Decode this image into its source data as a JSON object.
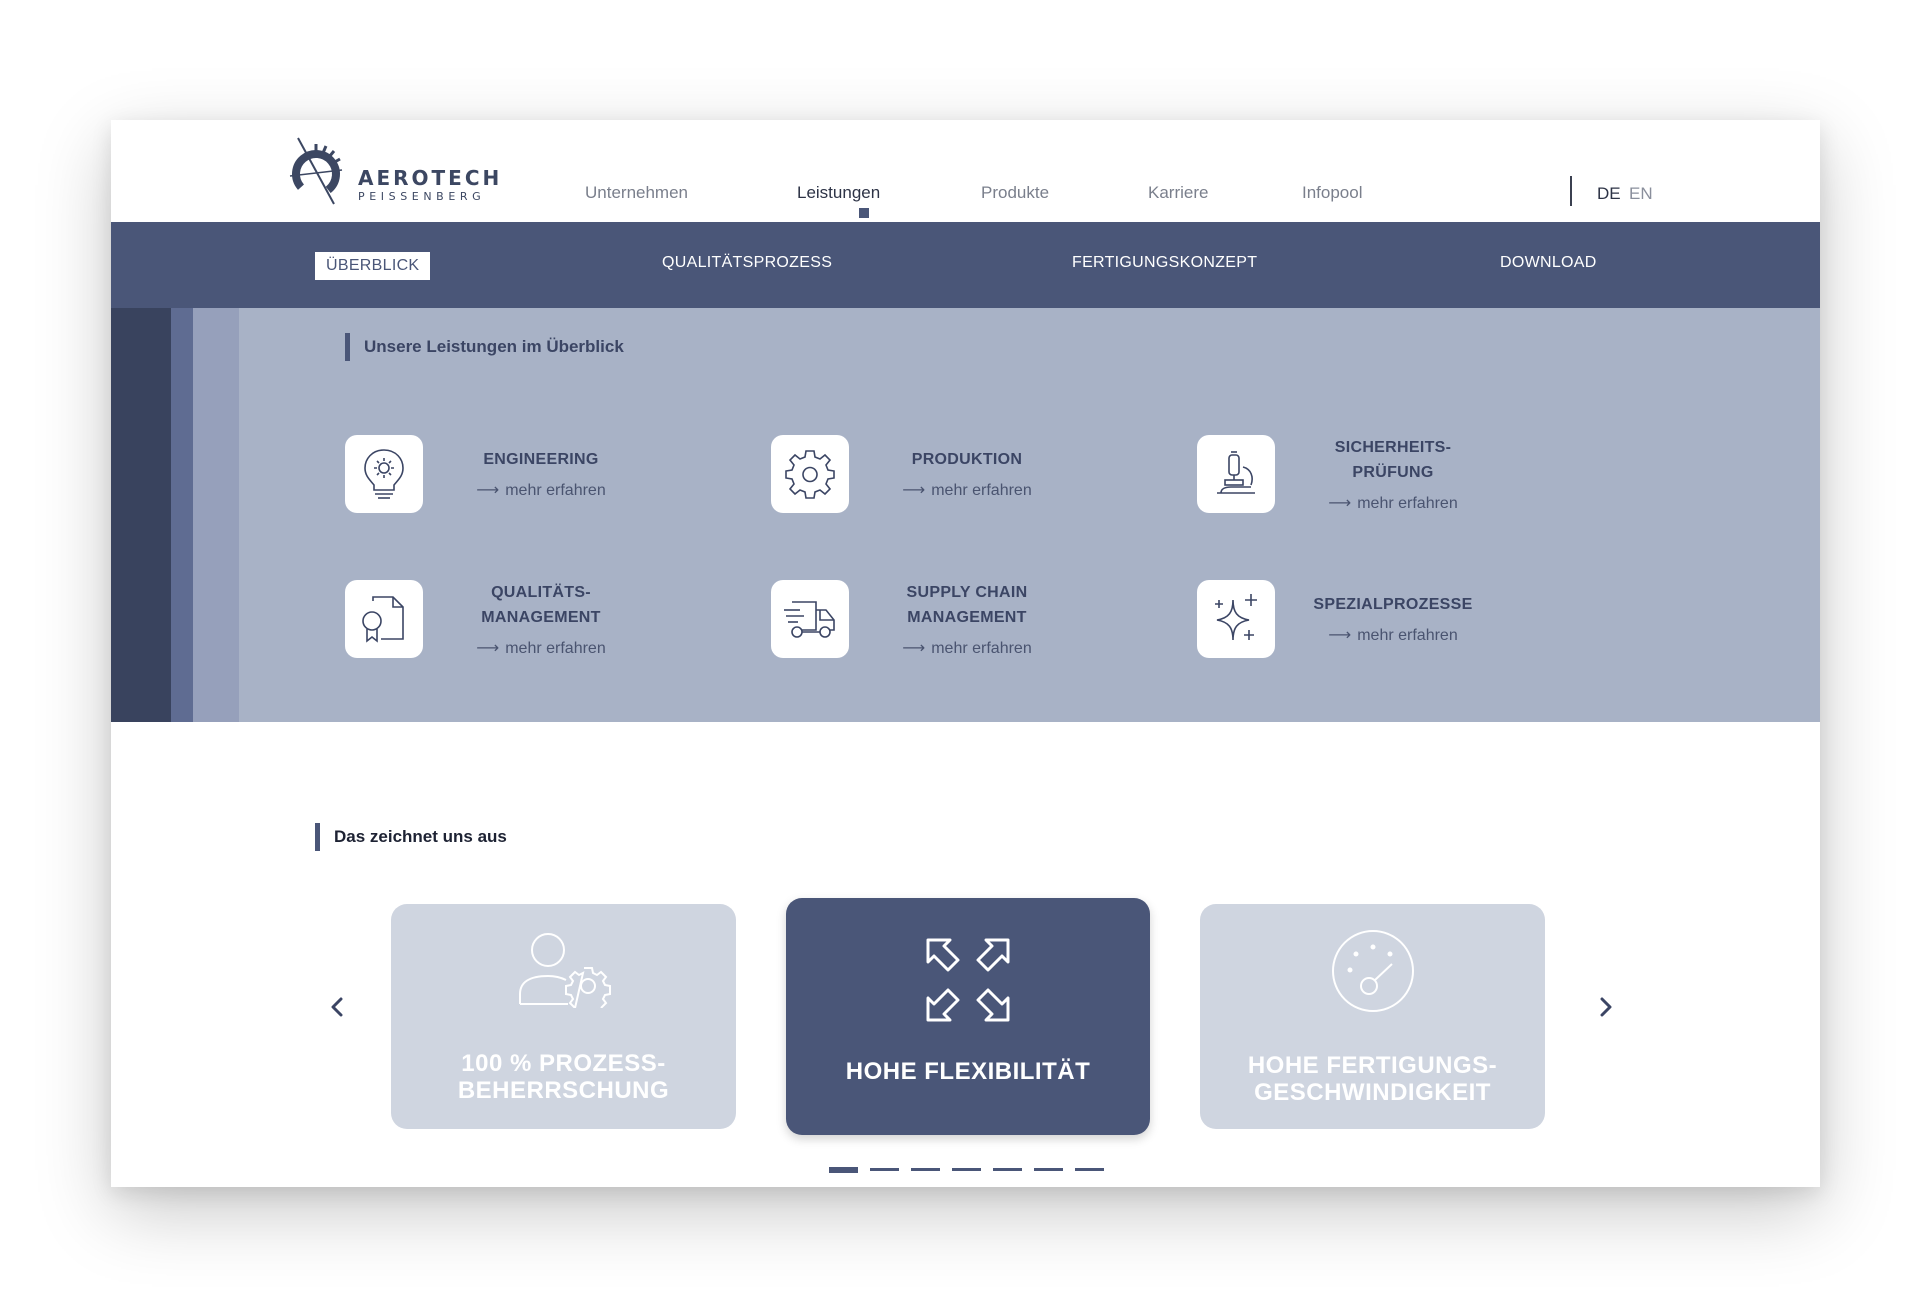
{
  "brand": {
    "name": "AEROTECH",
    "subname": "PEISSENBERG",
    "colors": {
      "primary": "#4a5678",
      "dark": "#39435e",
      "panel": "#a8b2c6",
      "card_inactive": "#cfd5e0"
    }
  },
  "nav": {
    "items": [
      {
        "label": "Unternehmen",
        "active": false
      },
      {
        "label": "Leistungen",
        "active": true
      },
      {
        "label": "Produkte",
        "active": false
      },
      {
        "label": "Karriere",
        "active": false
      },
      {
        "label": "Infopool",
        "active": false
      }
    ],
    "languages": [
      "DE",
      "EN"
    ],
    "active_language": "DE"
  },
  "subnav": {
    "items": [
      {
        "label": "ÜBERBLICK",
        "active": true
      },
      {
        "label": "QUALITÄTSPROZESS",
        "active": false
      },
      {
        "label": "FERTIGUNGSKONZEPT",
        "active": false
      },
      {
        "label": "DOWNLOAD",
        "active": false
      }
    ]
  },
  "overview": {
    "title": "Unsere Leistungen im Überblick",
    "services": [
      {
        "title": "ENGINEERING",
        "more": "mehr erfahren",
        "icon": "lightbulb-gear-icon"
      },
      {
        "title": "PRODUKTION",
        "more": "mehr erfahren",
        "icon": "gear-icon"
      },
      {
        "title": "SICHERHEITS-\nPRÜFUNG",
        "more": "mehr erfahren",
        "icon": "microscope-icon"
      },
      {
        "title": "QUALITÄTS-\nMANAGEMENT",
        "more": "mehr erfahren",
        "icon": "certificate-document-icon"
      },
      {
        "title": "SUPPLY CHAIN\nMANAGEMENT",
        "more": "mehr erfahren",
        "icon": "delivery-truck-icon"
      },
      {
        "title": "SPEZIALPROZESSE",
        "more": "mehr erfahren",
        "icon": "sparkle-icon"
      }
    ]
  },
  "features": {
    "title": "Das zeichnet uns aus",
    "cards": [
      {
        "label": "100 % PROZESS-\nBEHERRSCHUNG",
        "active": false,
        "icon": "user-gear-icon"
      },
      {
        "label": "HOHE FLEXIBILITÄT",
        "active": true,
        "icon": "expand-arrows-icon"
      },
      {
        "label": "HOHE FERTIGUNGS-\nGESCHWINDIGKEIT",
        "active": false,
        "icon": "speedometer-icon"
      }
    ],
    "pagination": {
      "count": 7,
      "active_index": 0
    }
  }
}
